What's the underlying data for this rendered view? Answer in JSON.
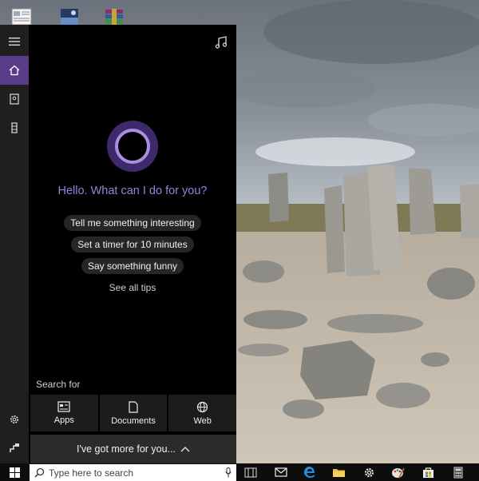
{
  "cortana": {
    "greeting": "Hello. What can I do for you?",
    "tips": [
      "Tell me something interesting",
      "Set a timer for 10 minutes",
      "Say something funny"
    ],
    "see_all_tips": "See all tips",
    "search_for_label": "Search for",
    "categories": [
      {
        "label": "Apps",
        "icon": "apps-icon"
      },
      {
        "label": "Documents",
        "icon": "document-icon"
      },
      {
        "label": "Web",
        "icon": "globe-icon"
      }
    ],
    "more_label": "I've got more for you...",
    "accent_color": "#9a7fe0"
  },
  "rail": {
    "items": [
      {
        "icon": "hamburger-menu-icon"
      },
      {
        "icon": "home-icon",
        "active": true
      },
      {
        "icon": "notebook-icon"
      },
      {
        "icon": "tower-icon"
      },
      {
        "icon": "settings-gear-icon"
      },
      {
        "icon": "feedback-icon"
      }
    ]
  },
  "taskbar": {
    "search_placeholder": "Type here to search",
    "icons": [
      "task-view-icon",
      "mail-icon",
      "edge-browser-icon",
      "file-explorer-icon",
      "settings-icon",
      "paint-icon",
      "store-icon",
      "calculator-icon"
    ]
  },
  "desktop": {
    "icons": [
      "document-file-icon",
      "image-file-icon",
      "archive-file-icon"
    ]
  }
}
